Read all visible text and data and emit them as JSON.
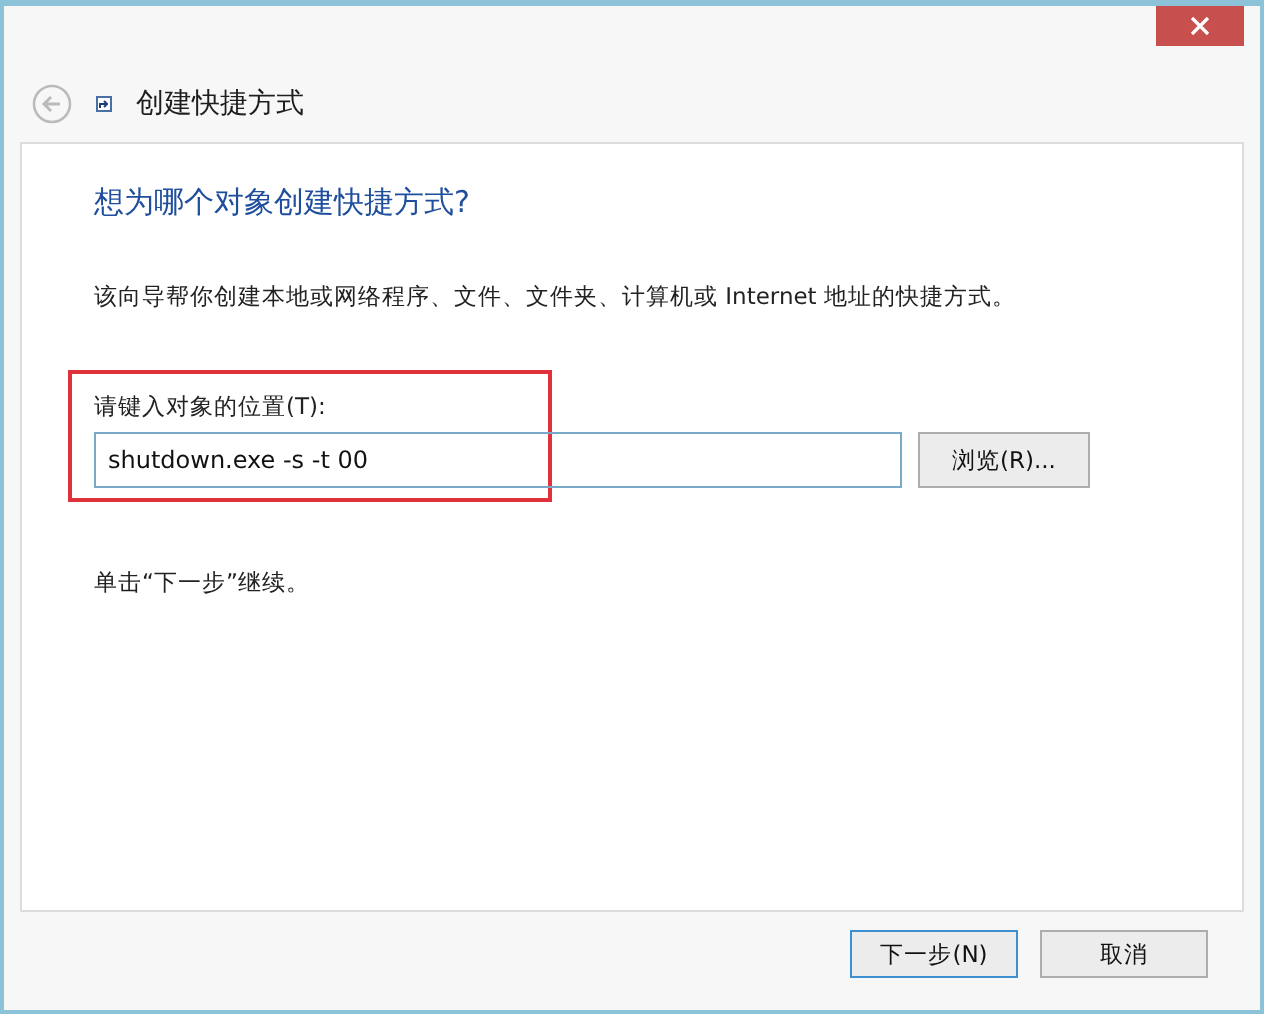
{
  "window": {
    "title": "创建快捷方式"
  },
  "heading": "想为哪个对象创建快捷方式?",
  "description": "该向导帮你创建本地或网络程序、文件、文件夹、计算机或 Internet 地址的快捷方式。",
  "location": {
    "label": "请键入对象的位置(T):",
    "value": "shutdown.exe -s -t 00",
    "highlighted": true
  },
  "browse_button": "浏览(R)...",
  "hint": "单击“下一步”继续。",
  "buttons": [
    {
      "label": "下一步(N)",
      "selected": true
    },
    {
      "label": "取消",
      "selected": false
    }
  ]
}
